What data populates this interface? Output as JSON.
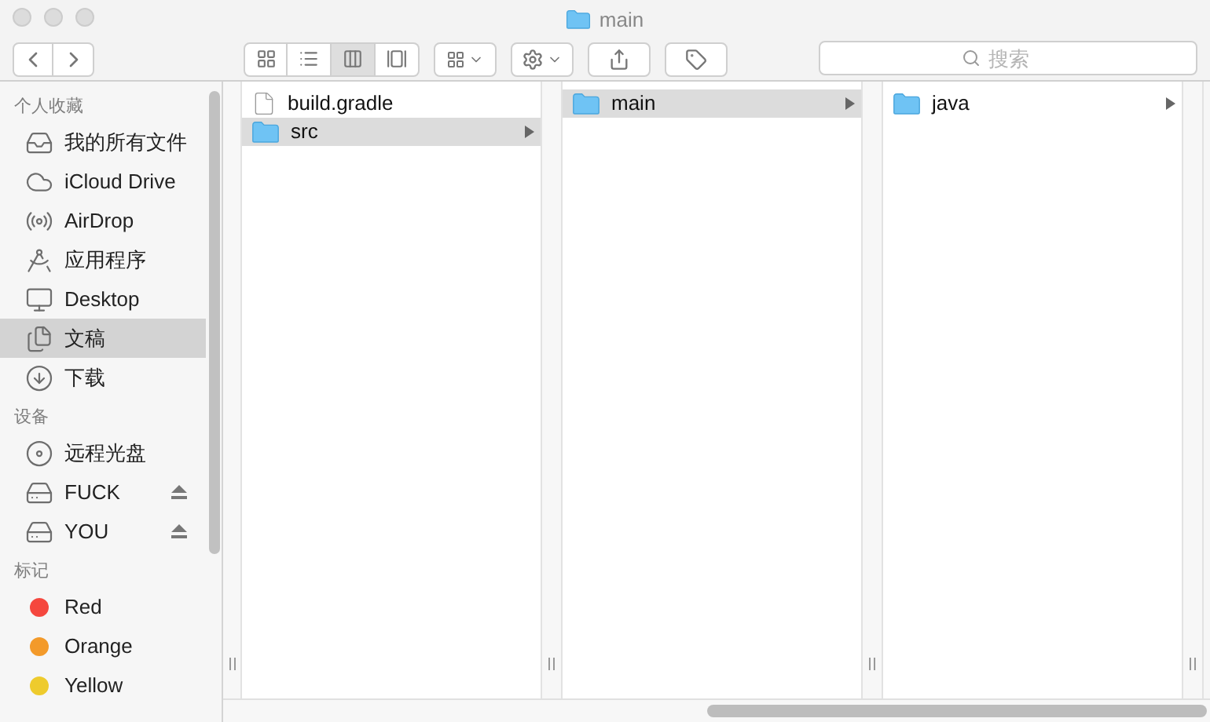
{
  "window": {
    "title": "main"
  },
  "toolbar": {
    "views": [
      {
        "kind": "icons",
        "selected": false
      },
      {
        "kind": "list",
        "selected": false
      },
      {
        "kind": "columns",
        "selected": true
      },
      {
        "kind": "coverflow",
        "selected": false
      }
    ],
    "search": {
      "placeholder": "搜索"
    }
  },
  "sidebar": {
    "sections": [
      {
        "title": "个人收藏",
        "items": [
          {
            "label": "我的所有文件",
            "kind": "allfiles",
            "selected": false
          },
          {
            "label": "iCloud Drive",
            "kind": "cloud",
            "selected": false
          },
          {
            "label": "AirDrop",
            "kind": "airdrop",
            "selected": false
          },
          {
            "label": "应用程序",
            "kind": "apps",
            "selected": false
          },
          {
            "label": "Desktop",
            "kind": "desktop",
            "selected": false
          },
          {
            "label": "文稿",
            "kind": "documents",
            "selected": true
          },
          {
            "label": "下载",
            "kind": "downloads",
            "selected": false
          }
        ]
      },
      {
        "title": "设备",
        "items": [
          {
            "label": "远程光盘",
            "kind": "disc",
            "selected": false
          },
          {
            "label": "FUCK",
            "kind": "drive",
            "selected": false,
            "ejectable": true
          },
          {
            "label": "YOU",
            "kind": "drive",
            "selected": false,
            "ejectable": true
          }
        ]
      },
      {
        "title": "标记",
        "items": [
          {
            "label": "Red",
            "kind": "tag",
            "color": "#f5473e",
            "selected": false
          },
          {
            "label": "Orange",
            "kind": "tag",
            "color": "#f39a2a",
            "selected": false
          },
          {
            "label": "Yellow",
            "kind": "tag",
            "color": "#eecb2d",
            "selected": false
          }
        ]
      }
    ]
  },
  "columns": [
    {
      "items": [
        {
          "name": "build.gradle",
          "kind": "file",
          "selected": false
        },
        {
          "name": "src",
          "kind": "folder",
          "selected": true
        }
      ]
    },
    {
      "items": [
        {
          "name": "main",
          "kind": "folder",
          "selected": true
        }
      ]
    },
    {
      "items": [
        {
          "name": "java",
          "kind": "folder",
          "selected": false
        }
      ]
    }
  ]
}
